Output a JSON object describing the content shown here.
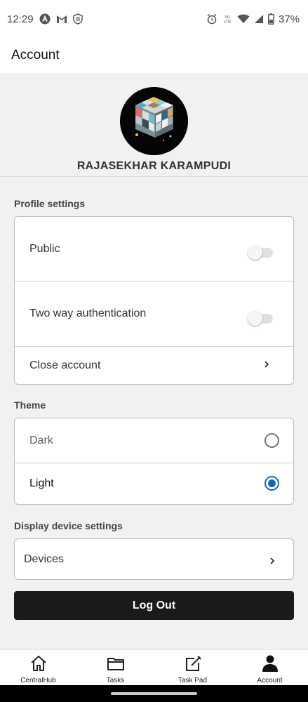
{
  "status_bar": {
    "time": "12:29",
    "left_icons": [
      "app-a-icon",
      "gmail-icon",
      "shield-icon"
    ],
    "right_icons": [
      "alarm-icon",
      "volte-icon",
      "wifi-icon",
      "signal-icon",
      "battery-icon"
    ],
    "volte_text": "Vo\nLTE",
    "battery": "37%"
  },
  "header": {
    "title": "Account"
  },
  "profile": {
    "name": "RAJASEKHAR KARAMPUDI",
    "avatar_icon": "rubiks-cube-avatar"
  },
  "profile_settings": {
    "label": "Profile settings",
    "items": [
      {
        "label": "Public",
        "type": "toggle",
        "on": false
      },
      {
        "label": "Two way authentication",
        "type": "toggle",
        "on": false
      },
      {
        "label": "Close account",
        "type": "link",
        "icon": "chevron-right-icon"
      }
    ]
  },
  "theme": {
    "label": "Theme",
    "options": [
      {
        "label": "Dark",
        "selected": false
      },
      {
        "label": "Light",
        "selected": true
      }
    ]
  },
  "device_settings": {
    "label": "Display device settings",
    "item": {
      "label": "Devices",
      "icon": "chevron-right-icon"
    }
  },
  "logout_label": "Log Out",
  "bottom_nav": [
    {
      "label": "CentralHub",
      "icon": "home-icon"
    },
    {
      "label": "Tasks",
      "icon": "folder-icon"
    },
    {
      "label": "Task Pad",
      "icon": "edit-icon"
    },
    {
      "label": "Account",
      "icon": "person-icon",
      "active": true
    }
  ],
  "colors": {
    "accent": "#1565c0",
    "button": "#1a1a1a",
    "background": "#f1f1f1"
  }
}
